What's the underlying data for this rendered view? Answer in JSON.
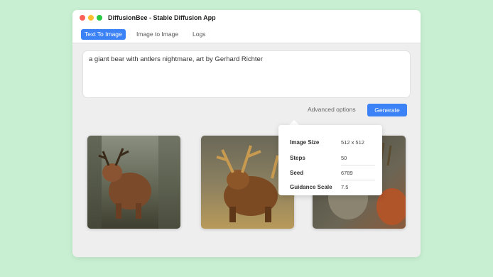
{
  "window": {
    "title": "DiffusionBee - Stable Diffusion App"
  },
  "tabs": [
    {
      "label": "Text To Image",
      "active": true
    },
    {
      "label": "Image to Image",
      "active": false
    },
    {
      "label": "Logs",
      "active": false
    }
  ],
  "prompt": {
    "value": "a giant bear with antlers nightmare, art by Gerhard Richter"
  },
  "actions": {
    "advanced_label": "Advanced options",
    "generate_label": "Generate"
  },
  "advanced": {
    "image_size": {
      "label": "Image Size",
      "value": "512 x 512"
    },
    "steps": {
      "label": "Steps",
      "value": "50"
    },
    "seed": {
      "label": "Seed",
      "value": "6789"
    },
    "guidance_scale": {
      "label": "Guidance Scale",
      "value": "7.5"
    }
  },
  "images": [
    {
      "subject": "bear-with-antlers-forest"
    },
    {
      "subject": "bear-with-antlers-field"
    },
    {
      "subject": "bear-with-antlers-dark"
    }
  ],
  "colors": {
    "background": "#c8efd2",
    "accent": "#3b82f6",
    "window": "#eeeeee"
  }
}
